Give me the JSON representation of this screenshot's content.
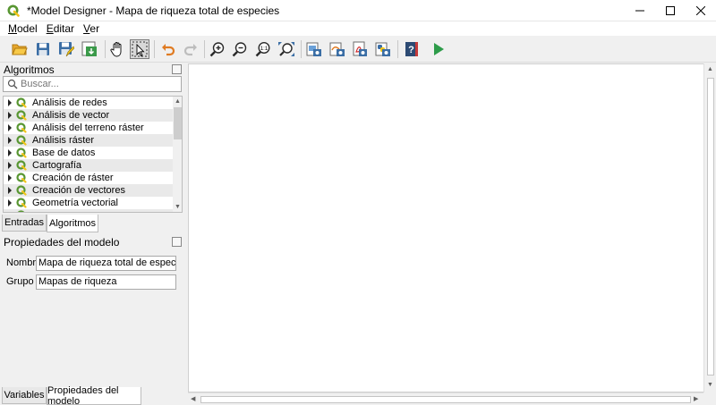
{
  "window": {
    "title": "*Model Designer - Mapa de riqueza total de especies",
    "controls": [
      "minimize",
      "maximize",
      "close"
    ]
  },
  "menubar": {
    "items": [
      {
        "label": "Model",
        "accel": "M"
      },
      {
        "label": "Editar",
        "accel": "E"
      },
      {
        "label": "Ver",
        "accel": "V"
      }
    ]
  },
  "toolbar": {
    "buttons": [
      "open-model",
      "save-model",
      "save-model-as",
      "save-to-project",
      "pan",
      "select",
      "undo",
      "redo",
      "zoom-in",
      "zoom-out",
      "zoom-actual",
      "zoom-full",
      "export-image",
      "export-svg",
      "export-pdf",
      "export-python",
      "help",
      "run-model"
    ],
    "active": "select"
  },
  "algorithms_panel": {
    "title": "Algoritmos",
    "search_placeholder": "Buscar...",
    "items": [
      {
        "label": "Análisis de redes"
      },
      {
        "label": "Análisis de vector"
      },
      {
        "label": "Análisis del terreno ráster"
      },
      {
        "label": "Análisis ráster"
      },
      {
        "label": "Base de datos"
      },
      {
        "label": "Cartografía"
      },
      {
        "label": "Creación de ráster"
      },
      {
        "label": "Creación de vectores"
      },
      {
        "label": "Geometría vectorial"
      }
    ],
    "tabs": [
      {
        "label": "Entradas",
        "selected": false
      },
      {
        "label": "Algoritmos",
        "selected": true
      }
    ]
  },
  "model_properties": {
    "title": "Propiedades del modelo",
    "name_label": "Nombre",
    "name_value": "Mapa de riqueza total de especies",
    "group_label": "Grupo",
    "group_value": "Mapas de riqueza",
    "tabs": [
      {
        "label": "Variables",
        "selected": false
      },
      {
        "label": "Propiedades del modelo",
        "selected": true
      }
    ]
  },
  "colors": {
    "qgis_green": "#589632",
    "qgis_yellow": "#f0c419",
    "run_green": "#2e9c4a",
    "undo_orange": "#e07b22"
  }
}
